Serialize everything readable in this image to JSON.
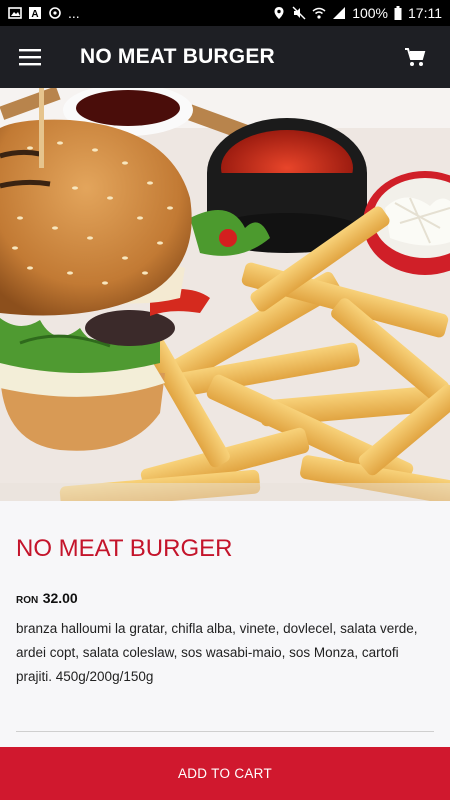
{
  "status_bar": {
    "left_icons": [
      "image-icon",
      "app-a-icon",
      "sync-icon"
    ],
    "dots": "...",
    "right_icons": [
      "location-icon",
      "mute-icon",
      "wifi-icon",
      "signal-icon"
    ],
    "battery": "100%",
    "time": "17:11"
  },
  "appbar": {
    "title": "NO MEAT BURGER",
    "menu_icon": "menu-icon",
    "cart_icon": "cart-icon"
  },
  "product": {
    "name": "NO MEAT BURGER",
    "currency": "RON",
    "price": "32.00",
    "description": "branza halloumi la gratar, chifla alba, vinete, dovlecel, salata verde, ardei copt,  salata coleslaw, sos wasabi-maio, sos Monza,  cartofi prajiti. 450g/200g/150g"
  },
  "add_to_cart_label": "ADD TO CART",
  "colors": {
    "accent": "#c4142b",
    "button": "#d0182e",
    "appbar": "#1e1f24"
  }
}
